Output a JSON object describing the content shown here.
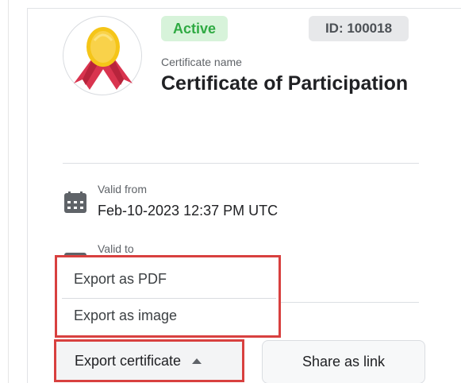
{
  "certificate": {
    "status_badge": "Active",
    "id_badge": "ID: 100018",
    "name_label": "Certificate name",
    "name_value": "Certificate of Participation"
  },
  "validity": {
    "from_label": "Valid from",
    "from_value": "Feb-10-2023 12:37 PM UTC",
    "to_label": "Valid to"
  },
  "export_menu": {
    "items": [
      "Export as PDF",
      "Export as image"
    ]
  },
  "actions": {
    "export_label": "Export certificate",
    "share_label": "Share as link"
  },
  "colors": {
    "active_badge_bg": "#d7f3da",
    "active_badge_text": "#2faa43",
    "id_badge_bg": "#e7e8ea",
    "highlight_border": "#d8403f",
    "medal_gold": "#f5c518",
    "ribbon_red": "#d9344f"
  },
  "icons": {
    "medal": "medal-icon",
    "calendar": "calendar-icon",
    "caret": "caret-up-icon"
  }
}
